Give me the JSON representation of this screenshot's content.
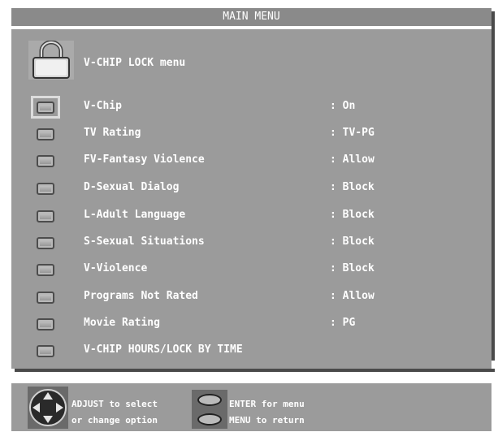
{
  "title": "MAIN MENU",
  "header": "V-CHIP LOCK menu",
  "items": [
    {
      "label": "V-Chip",
      "value": ": On"
    },
    {
      "label": "TV Rating",
      "value": ": TV-PG"
    },
    {
      "label": "FV-Fantasy Violence",
      "value": ": Allow"
    },
    {
      "label": "D-Sexual Dialog",
      "value": ": Block"
    },
    {
      "label": "L-Adult Language",
      "value": ": Block"
    },
    {
      "label": "S-Sexual Situations",
      "value": ": Block"
    },
    {
      "label": "V-Violence",
      "value": ": Block"
    },
    {
      "label": "Programs Not Rated",
      "value": ": Allow"
    },
    {
      "label": "Movie Rating",
      "value": ": PG"
    },
    {
      "label": "V-CHIP HOURS/LOCK BY TIME",
      "value": ""
    }
  ],
  "help": {
    "adjust_line1": "ADJUST to select",
    "adjust_line2": "or change option",
    "enter": "ENTER for menu",
    "menu": "MENU  to  return"
  },
  "icons": {
    "lock": "padlock-icon",
    "item": "tv-icon",
    "adjust": "directional-pad-icon",
    "button": "oval-button-icon"
  }
}
